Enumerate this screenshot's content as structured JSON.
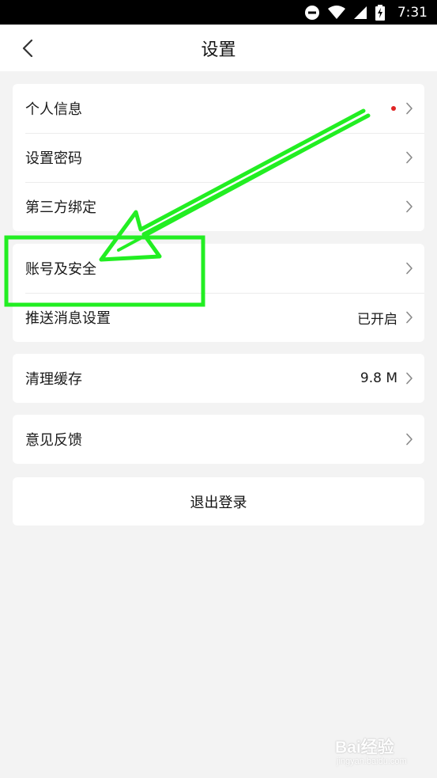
{
  "status_bar": {
    "time": "7:31",
    "icons": [
      "do-not-disturb-icon",
      "wifi-icon",
      "signal-icon",
      "battery-charging-icon"
    ]
  },
  "header": {
    "title": "设置",
    "back_icon": "chevron-left-icon"
  },
  "groups": [
    {
      "items": [
        {
          "label": "个人信息",
          "badge": "red-dot",
          "value": ""
        },
        {
          "label": "设置密码",
          "value": ""
        },
        {
          "label": "第三方绑定",
          "value": ""
        }
      ]
    },
    {
      "items": [
        {
          "label": "账号及安全",
          "value": ""
        },
        {
          "label": "推送消息设置",
          "value": "已开启"
        }
      ]
    },
    {
      "items": [
        {
          "label": "清理缓存",
          "value": "9.8 M"
        }
      ]
    },
    {
      "items": [
        {
          "label": "意见反馈",
          "value": ""
        }
      ]
    }
  ],
  "logout": {
    "label": "退出登录"
  },
  "colors": {
    "background": "#f3f3f3",
    "badge": "#e02424",
    "annotation": "#22ee22"
  },
  "watermark": {
    "main": "Bai经验",
    "sub": "jingyan.baidu.com"
  }
}
